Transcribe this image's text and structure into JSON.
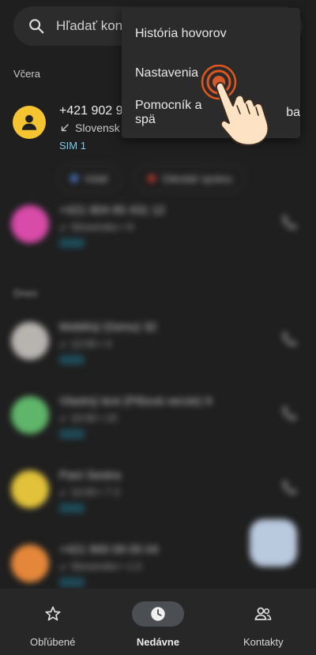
{
  "search": {
    "placeholder": "Hľadať kont"
  },
  "sections": {
    "yesterday": "Včera",
    "today": "Dnes"
  },
  "first_call": {
    "number": "+421 902 9",
    "type_icon": "call-received-icon",
    "location": "Slovensk",
    "sim": "SIM 1",
    "avatar_color": "#f5c531"
  },
  "actions": [
    {
      "label": "Volať",
      "color": "#4a7bd0"
    },
    {
      "label": "Odoslať správu",
      "color": "#c0392b"
    }
  ],
  "menu": {
    "items": [
      {
        "label": "História hovorov"
      },
      {
        "label": "Nastavenia"
      },
      {
        "label": "Pomocník a spätná väzba"
      }
    ],
    "visible_items": [
      "História hovorov",
      "Nastavenia",
      "Pomocník a spä",
      "ba"
    ]
  },
  "rows": [
    {
      "avatar_color": "#d84ba9",
      "name": "+421 904 65 431 12",
      "sub": "↙ Slovensko • 9"
    },
    {
      "avatar_color": "#b7b4b0",
      "name": "Mobilný (Genu) 32",
      "sub": "↙ 12:00 • 4"
    },
    {
      "avatar_color": "#5fb56a",
      "name": "Vlastný text (Pišová verzie) 9",
      "sub": "↙ 10:00 • 10"
    },
    {
      "avatar_color": "#e2c23a",
      "name": "Pani Sestra",
      "sub": "↙ 10:00 • 7 2"
    },
    {
      "avatar_color": "#e5873a",
      "name": "+421 900 09 05 04",
      "sub": "↙ Slovensko • 1:2"
    }
  ],
  "colors": {
    "accent_sim": "#7ec8e8",
    "background": "#1f1f1f",
    "menu_bg": "#2b2b2b",
    "tap_ring": "#e0561f"
  },
  "bottom_nav": [
    {
      "label": "Obľúbené",
      "icon": "star-icon",
      "active": false
    },
    {
      "label": "Nedávne",
      "icon": "clock-icon",
      "active": true
    },
    {
      "label": "Kontakty",
      "icon": "people-icon",
      "active": false
    }
  ]
}
